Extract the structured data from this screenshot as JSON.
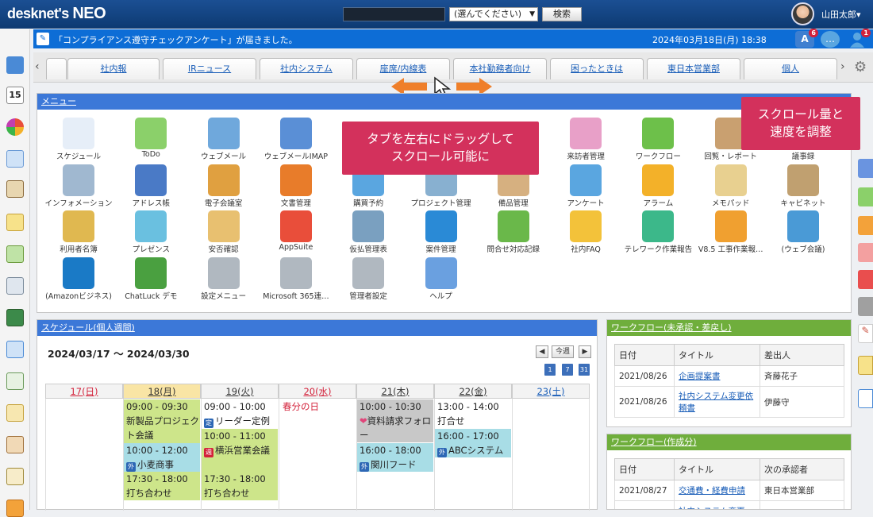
{
  "header": {
    "logo_main": "desknet's",
    "logo_neo": "NEO",
    "search_placeholder": "",
    "search_select": "(選んでください)",
    "search_button": "検索",
    "user_name": "山田太郎▾"
  },
  "notice": {
    "text": "「コンプライアンス遵守チェックアンケート」が届きました。",
    "datetime": "2024年03月18日(月) 18:38",
    "badges": {
      "a": "6",
      "person": "1"
    }
  },
  "tabs": [
    "社内報",
    "IRニュース",
    "社内システム",
    "座席/内線表",
    "本社勤務者向け",
    "困ったときは",
    "東日本営業部",
    "個人"
  ],
  "menu": {
    "title": "メニュー",
    "items": [
      [
        "スケジュール",
        "ToDo",
        "ウェブメール",
        "ウェブメールIMAP",
        "",
        "",
        "",
        "来訪者管理",
        "ワークフロー",
        "回覧・レポート",
        "議事録"
      ],
      [
        "インフォメーション",
        "アドレス帳",
        "電子会議室",
        "文書管理",
        "購買予約",
        "プロジェクト管理",
        "備品管理",
        "アンケート",
        "アラーム",
        "メモパッド",
        "キャビネット"
      ],
      [
        "利用者名簿",
        "プレゼンス",
        "安否確認",
        "AppSuite",
        "仮払管理表",
        "案件管理",
        "問合せ対応記録",
        "社内FAQ",
        "テレワーク作業報告",
        "V8.5 工事作業報…",
        "(ウェブ会議)"
      ],
      [
        "(Amazonビジネス)",
        "ChatLuck デモ",
        "設定メニュー",
        "Microsoft 365連…",
        "管理者設定",
        "ヘルプ"
      ]
    ]
  },
  "callouts": {
    "tab_drag": "タブを左右にドラッグして\nスクロール可能に",
    "scroll": "スクロール量と\n速度を調整"
  },
  "schedule": {
    "title": "スケジュール(個人週間)",
    "range": "2024/03/17 ～ 2024/03/30",
    "today_button": "今週",
    "days": [
      "17(日)",
      "18(月)",
      "19(火)",
      "20(水)",
      "21(木)",
      "22(金)",
      "23(土)"
    ],
    "holiday": "春分の日",
    "events": {
      "mon": [
        {
          "time": "09:00 - 09:30",
          "title": "新製品プロジェクト会議"
        },
        {
          "time": "10:00 - 12:00",
          "title": "小麦商事",
          "badge": "外"
        },
        {
          "time": "17:30 - 18:00",
          "title": "打ち合わせ"
        }
      ],
      "tue": [
        {
          "time": "09:00 - 10:00",
          "title": "リーダー定例",
          "badge": "定"
        },
        {
          "time": "10:00 - 11:00",
          "title": "横浜営業会議",
          "badge": "週"
        },
        {
          "time": "17:30 - 18:00",
          "title": "打ち合わせ"
        }
      ],
      "thu": [
        {
          "time": "10:00 - 10:30",
          "title": "資料請求フォロー"
        },
        {
          "time": "16:00 - 18:00",
          "title": "関川フード",
          "badge": "外"
        }
      ],
      "fri": [
        {
          "time": "13:00 - 14:00",
          "title": "打合せ"
        },
        {
          "time": "16:00 - 17:00",
          "title": "ABCシステム",
          "badge": "外"
        }
      ]
    }
  },
  "workflow_pending": {
    "title": "ワークフロー(未承認・差戻し)",
    "headers": [
      "日付",
      "タイトル",
      "差出人"
    ],
    "rows": [
      [
        "2021/08/26",
        "企画提案書",
        "斉藤花子"
      ],
      [
        "2021/08/26",
        "社内システム変更依頼書",
        "伊藤守"
      ]
    ]
  },
  "workflow_created": {
    "title": "ワークフロー(作成分)",
    "headers": [
      "日付",
      "タイトル",
      "次の承認者"
    ],
    "rows": [
      [
        "2021/08/27",
        "交通費・経費申請",
        "東日本営業部"
      ],
      [
        "",
        "社内システム変更",
        ""
      ]
    ]
  }
}
